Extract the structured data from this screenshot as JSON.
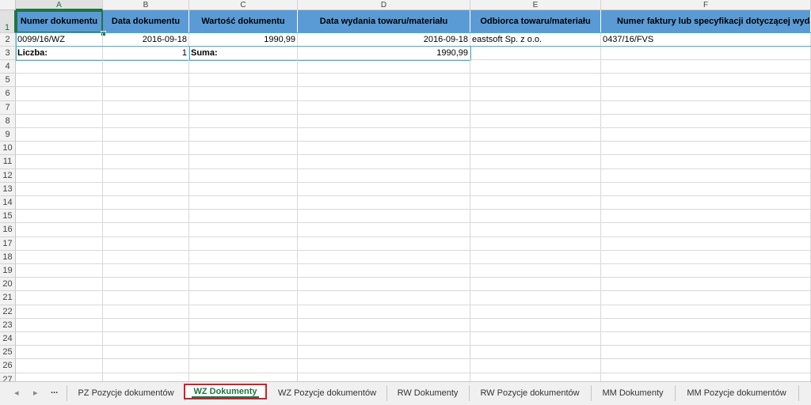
{
  "columns": [
    "A",
    "B",
    "C",
    "D",
    "E",
    "F"
  ],
  "header_row": [
    "Numer dokumentu",
    "Data dokumentu",
    "Wartość dokumentu",
    "Data wydania towaru/materiału",
    "Odbiorca towaru/materiału",
    "Numer faktury lub specyfikacji dotyczącej wyda"
  ],
  "data_row": [
    "0099/16/WZ",
    "2016-09-18",
    "1990,99",
    "2016-09-18",
    "eastsoft Sp. z o.o.",
    "0437/16/FVS"
  ],
  "summary_row": {
    "count_label": "Liczba:",
    "count_value": "1",
    "sum_label": "Suma:",
    "sum_value": "1990,99"
  },
  "row_numbers": [
    "1",
    "2",
    "3",
    "4",
    "5",
    "6",
    "7",
    "8",
    "9",
    "10",
    "11",
    "12",
    "13",
    "14",
    "15",
    "16",
    "17",
    "18",
    "19",
    "20",
    "21",
    "22",
    "23",
    "24",
    "25",
    "26",
    "27"
  ],
  "sheet_tabs": {
    "ellipsis": "...",
    "prev_icon": "◂",
    "next_icon": "▸",
    "tabs": [
      "PZ Pozycje dokumentów",
      "WZ Dokumenty",
      "WZ Pozycje dokumentów",
      "RW Dokumenty",
      "RW Pozycje dokumentów",
      "MM Dokumenty",
      "MM Pozycje dokumentów"
    ],
    "active": "WZ Dokumenty"
  },
  "colors": {
    "header_fill": "#5b9bd5",
    "table_border": "#3cb4d8",
    "excel_green": "#217346",
    "highlight": "#d0202a"
  }
}
